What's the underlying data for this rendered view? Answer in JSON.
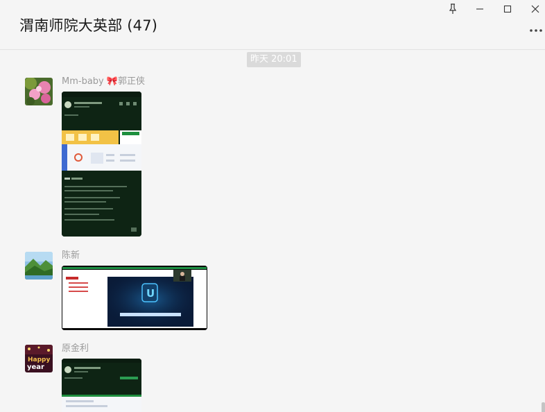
{
  "window": {
    "title": "渭南师院大英部 (47)",
    "controls": [
      "pin-icon",
      "minimize-icon",
      "maximize-icon",
      "close-icon"
    ],
    "more_icon": "more-horizontal-icon"
  },
  "chat": {
    "timestamp": "昨天 20:01",
    "messages": [
      {
        "sender": "Mm-baby 🎀郭正侠",
        "avatar": "flower-photo-avatar",
        "type": "image",
        "content": "phone-screenshot-image"
      },
      {
        "sender": "陈新",
        "avatar": "landscape-avatar",
        "type": "image",
        "content": "video-meeting-screenshot-image"
      },
      {
        "sender": "原金利",
        "avatar": "new-year-avatar",
        "type": "image",
        "content": "phone-screenshot-image"
      }
    ]
  },
  "colors": {
    "background": "#f5f5f5",
    "sender_text": "#9a9a9a",
    "timestamp_chip": "#dadada"
  }
}
